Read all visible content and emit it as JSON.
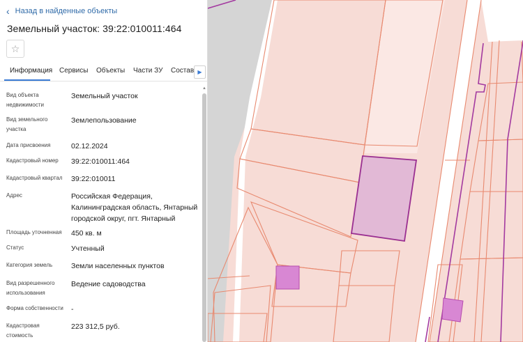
{
  "panel": {
    "back_label": "Назад в найденные объекты",
    "title": "Земельный участок: 39:22:010011:464",
    "tabs": [
      "Информация",
      "Сервисы",
      "Объекты",
      "Части ЗУ",
      "Состав"
    ],
    "active_tab": "Информация",
    "properties": [
      {
        "label": "Вид объекта недвижимости",
        "value": "Земельный участок"
      },
      {
        "label": "Вид земельного участка",
        "value": "Землепользование"
      },
      {
        "label": "Дата присвоения",
        "value": "02.12.2024"
      },
      {
        "label": "Кадастровый номер",
        "value": "39:22:010011:464"
      },
      {
        "label": "Кадастровый квартал",
        "value": "39:22:010011"
      },
      {
        "label": "Адрес",
        "value": "Российская Федерация, Калининградская область, Янтарный городской округ, пгт. Янтарный"
      },
      {
        "label": "Площадь уточненная",
        "value": "450 кв. м"
      },
      {
        "label": "Статус",
        "value": "Учтенный"
      },
      {
        "label": "Категория земель",
        "value": "Земли населенных пунктов"
      },
      {
        "label": "Вид разрешенного использования",
        "value": "Ведение садоводства"
      },
      {
        "label": "Форма собственности",
        "value": "-"
      },
      {
        "label": "Кадастровая стоимость",
        "value": "223 312,5 руб."
      }
    ]
  },
  "icons": {
    "back": "chevron-left-icon",
    "favorite": "star-icon",
    "tabs_next": "chevron-right-icon"
  },
  "colors": {
    "accent": "#2f6aa8",
    "parcel_fill": "#f7dcd6",
    "parcel_border": "#e8896f",
    "selected_fill": "#e2b9d6",
    "selected_border": "#9a2f91",
    "magenta_marker": "#d887d3"
  }
}
